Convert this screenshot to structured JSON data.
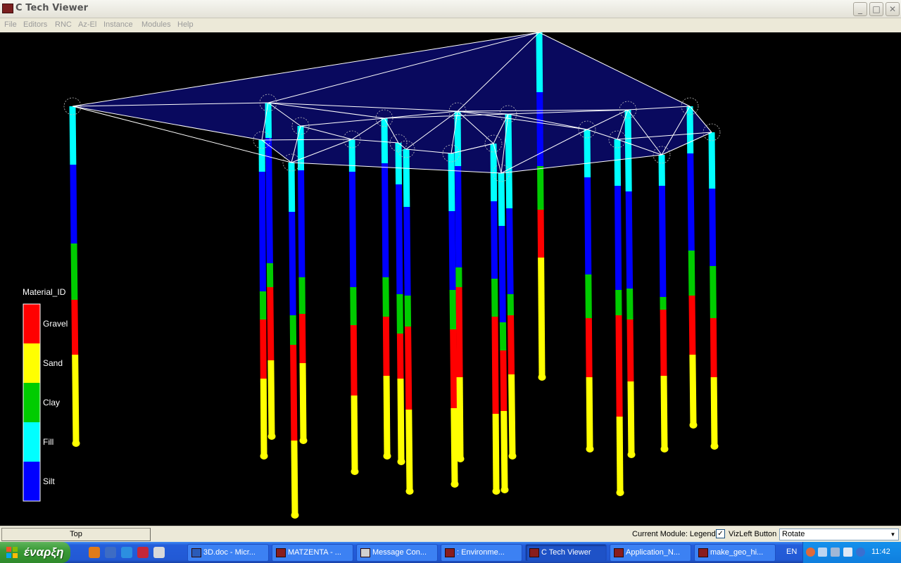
{
  "window": {
    "title": "C Tech Viewer",
    "controls": [
      "minimize",
      "maximize",
      "close"
    ]
  },
  "menu": [
    "File",
    "Editors",
    "RNC",
    "Az-El",
    "Instance",
    "Modules",
    "Help"
  ],
  "legend": {
    "title": "Material_ID",
    "items": [
      {
        "label": "Gravel",
        "color": "#ff0000"
      },
      {
        "label": "Sand",
        "color": "#ffff00"
      },
      {
        "label": "Clay",
        "color": "#00cc00"
      },
      {
        "label": "Fill",
        "color": "#00ffff"
      },
      {
        "label": "Silt",
        "color": "#0000ff"
      }
    ]
  },
  "colors": {
    "gravel": "#ff0000",
    "sand": "#ffff00",
    "clay": "#00cc00",
    "fill": "#00ffff",
    "silt": "#0000ff",
    "surface": "#0a0a6e",
    "wire": "#ffffff"
  },
  "bottom_bar": {
    "top_button": "Top",
    "current_module": "Current Module: Legend",
    "vizleft_label": "VizLeft Button",
    "vizleft_checked": true,
    "mode_value": "Rotate"
  },
  "taskbar": {
    "start_label": "έναρξη",
    "buttons": [
      {
        "label": "3D.doc - Micr...",
        "icon": "word-icon"
      },
      {
        "label": "MATZENTA - ...",
        "icon": "app-icon"
      },
      {
        "label": "Message Con...",
        "icon": "message-icon"
      },
      {
        "label": ": Environme...",
        "icon": "ctech-icon"
      },
      {
        "label": "C Tech Viewer",
        "icon": "ctech-icon",
        "active": true
      },
      {
        "label": "Application_N...",
        "icon": "ctech-icon"
      },
      {
        "label": "make_geo_hi...",
        "icon": "ctech-icon"
      }
    ],
    "language": "EN",
    "clock": "11:42"
  }
}
